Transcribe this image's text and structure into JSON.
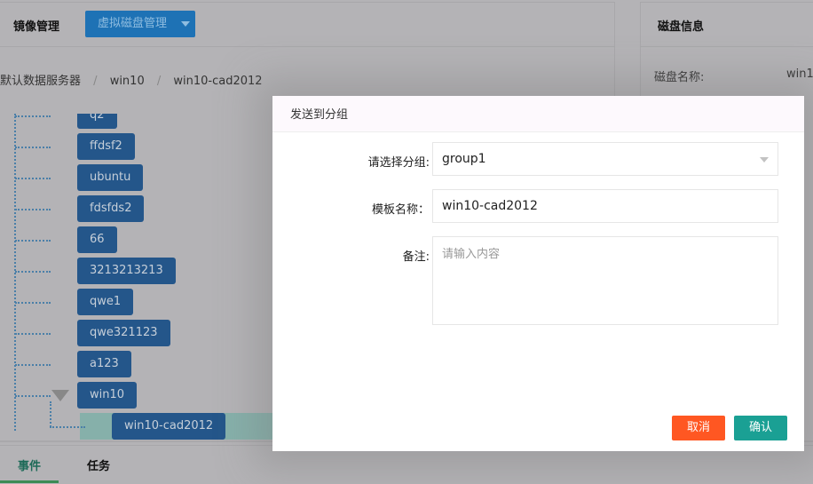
{
  "header": {
    "title": "镜像管理",
    "dropdown_label": "虚拟磁盘管理"
  },
  "breadcrumb": [
    "默认数据服务器",
    "win10",
    "win10-cad2012"
  ],
  "tree": {
    "nodes": [
      "q2",
      "ffdsf2",
      "ubuntu",
      "fdsfds2",
      "66",
      "3213213213",
      "qwe1",
      "qwe321123",
      "a123",
      "win10"
    ],
    "child": "win10-cad2012"
  },
  "disk_info": {
    "title": "磁盘信息",
    "name_label": "磁盘名称:",
    "name_value": "win1"
  },
  "bottom_tabs": [
    "事件",
    "任务"
  ],
  "modal": {
    "title": "发送到分组",
    "group_label": "请选择分组:",
    "group_value": "group1",
    "template_label": "模板名称：",
    "template_value": "win10-cad2012",
    "remark_label": "备注:",
    "remark_placeholder": "请输入内容",
    "cancel": "取消",
    "confirm": "确认"
  },
  "colors": {
    "primary": "#1e88d0",
    "node": "#24568a",
    "cancel": "#ff5722",
    "confirm": "#1aa094"
  }
}
